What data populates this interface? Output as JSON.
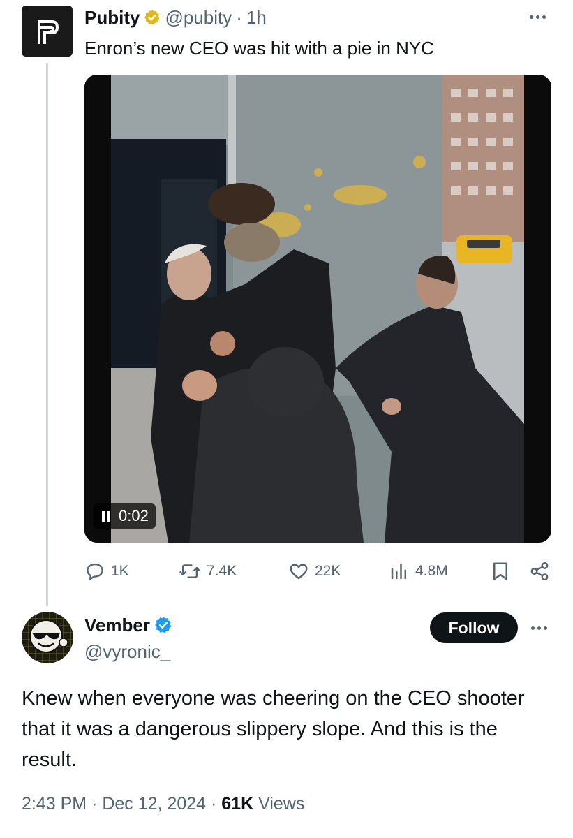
{
  "quoted_tweet": {
    "author_name": "Pubity",
    "author_handle": "@pubity",
    "separator": "·",
    "time_ago": "1h",
    "text": "Enron’s new CEO was hit with a pie in NYC",
    "avatar_icon": "pubity-logo-icon",
    "video": {
      "state": "playing",
      "elapsed": "0:02"
    },
    "stats": {
      "replies": "1K",
      "reposts": "7.4K",
      "likes": "22K",
      "views": "4.8M"
    }
  },
  "reply_tweet": {
    "author_name": "Vember",
    "author_handle": "@vyronic_",
    "follow_label": "Follow",
    "text": "Knew when everyone was cheering on the CEO shooter that it was a dangerous slippery slope. And this is the result.",
    "time": "2:43 PM",
    "date": "Dec 12, 2024",
    "view_count": "61K",
    "views_label": "Views",
    "separator": "·"
  },
  "colors": {
    "verified_gold": "#e2b719",
    "verified_blue": "#1d9bf0",
    "muted_text": "#536471",
    "primary_text": "#0f1419",
    "taxi_yellow": "#e8b623"
  }
}
